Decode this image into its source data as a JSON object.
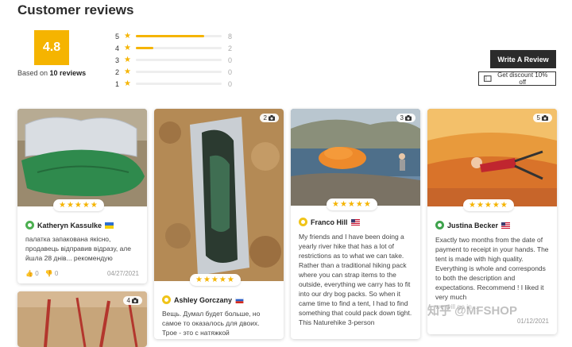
{
  "header": {
    "title": "Customer reviews"
  },
  "summary": {
    "rating": "4.8",
    "based_prefix": "Based on",
    "based_count": "10 reviews"
  },
  "breakdown": [
    {
      "stars": "5",
      "count": "8",
      "fraction": 0.8
    },
    {
      "stars": "4",
      "count": "2",
      "fraction": 0.2
    },
    {
      "stars": "3",
      "count": "0",
      "fraction": 0
    },
    {
      "stars": "2",
      "count": "0",
      "fraction": 0
    },
    {
      "stars": "1",
      "count": "0",
      "fraction": 0
    }
  ],
  "actions": {
    "write_review": "Write A Review",
    "discount": "Get discount 10% off"
  },
  "star_glyphs": "★★★★★",
  "reviews": [
    {
      "name": "Katheryn Kassulke",
      "flag": "Ukraine",
      "text": "палатка запакована якісно, продавець відправив відразу, але йшла 28 днів... рекомендую",
      "likes": "0",
      "dislikes": "0",
      "date": "04/27/2021"
    },
    {
      "name": "Ashley Gorczany",
      "flag": "Russia",
      "photo_count": "2",
      "text": "Вещь. Думал будет больше, но самое то оказалось для двоих. Трое - это с натяжкой"
    },
    {
      "name": "Franco Hill",
      "flag": "United States",
      "photo_count": "3",
      "text": "My friends and I have been doing a yearly river hike that has a lot of restrictions as to what we can take. Rather than a traditional hiking pack where you can strap items to the outside, everything we carry has to fit into our dry bog packs. So when it came time to find a tent, I had to find something that could pack down tight. This Naturehike 3-person"
    },
    {
      "name": "Justina Becker",
      "flag": "United States",
      "photo_count": "5",
      "text": "Exactly two months from the date of payment to receipt in your hands. The tent is made with high quality. Everything is whole and corresponds to both the description and expectations. Recommend ! I liked it very much",
      "text_faded": "we will go in ...",
      "date": "01/12/2021"
    },
    {
      "photo_count": "4"
    }
  ],
  "watermark": "知乎 @MFSHOP"
}
